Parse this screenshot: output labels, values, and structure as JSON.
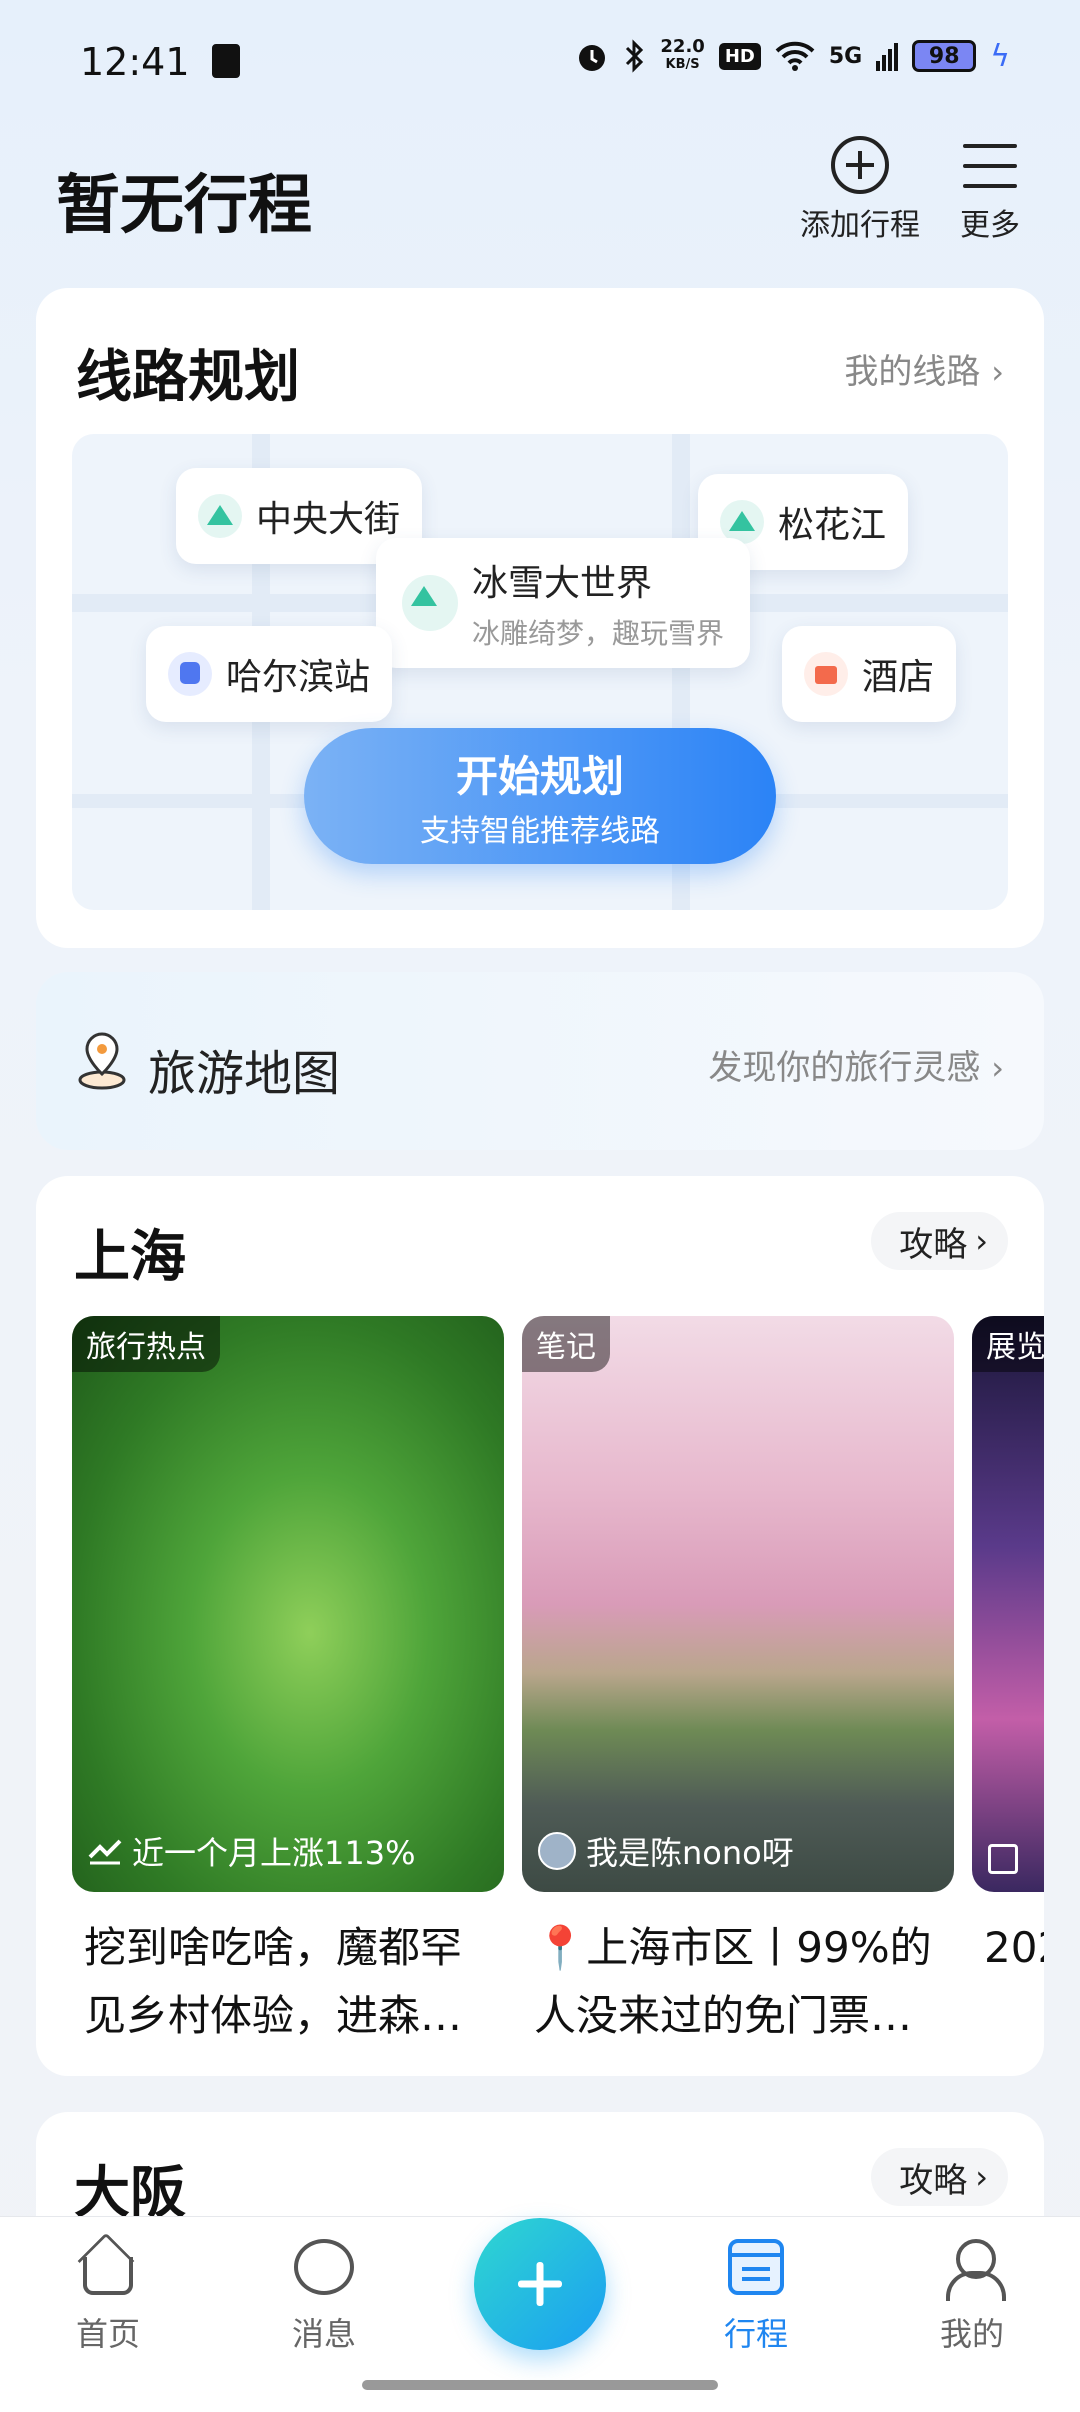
{
  "status_bar": {
    "time": "12:41",
    "net_speed_value": "22.0",
    "net_speed_unit": "KB/S",
    "hd_label": "HD",
    "signal_label": "5G",
    "battery": "98"
  },
  "header": {
    "title": "暂无行程",
    "add_label": "添加行程",
    "more_label": "更多"
  },
  "route_planning": {
    "title": "线路规划",
    "my_routes_link": "我的线路",
    "pins": {
      "central_street": "中央大街",
      "songhua_river": "松花江",
      "ice_world": "冰雪大世界",
      "ice_world_sub": "冰雕绮梦，趣玩雪界",
      "harbin_station": "哈尔滨站",
      "hotel": "酒店"
    },
    "start_button": "开始规划",
    "start_button_sub": "支持智能推荐线路"
  },
  "tour_map": {
    "title": "旅游地图",
    "link": "发现你的旅行灵感"
  },
  "city_shanghai": {
    "name": "上海",
    "guide_label": "攻略",
    "cards": [
      {
        "tag": "旅行热点",
        "overlay": "近一个月上涨113%",
        "title": "挖到啥吃啥，魔都罕见乡村体验，进森林..."
      },
      {
        "tag": "笔记",
        "overlay": "我是陈nono呀",
        "title": "📍上海市区丨99%的人没来过的免门票樱..."
      },
      {
        "tag": "展览",
        "overlay": "",
        "title": "202"
      }
    ]
  },
  "city_osaka": {
    "name": "大阪",
    "guide_label": "攻略"
  },
  "tabbar": {
    "home": "首页",
    "messages": "消息",
    "trips": "行程",
    "me": "我的"
  },
  "colors": {
    "accent": "#1f86f0",
    "start_button": "#2b83f6",
    "fab": "#1fb8e8"
  }
}
